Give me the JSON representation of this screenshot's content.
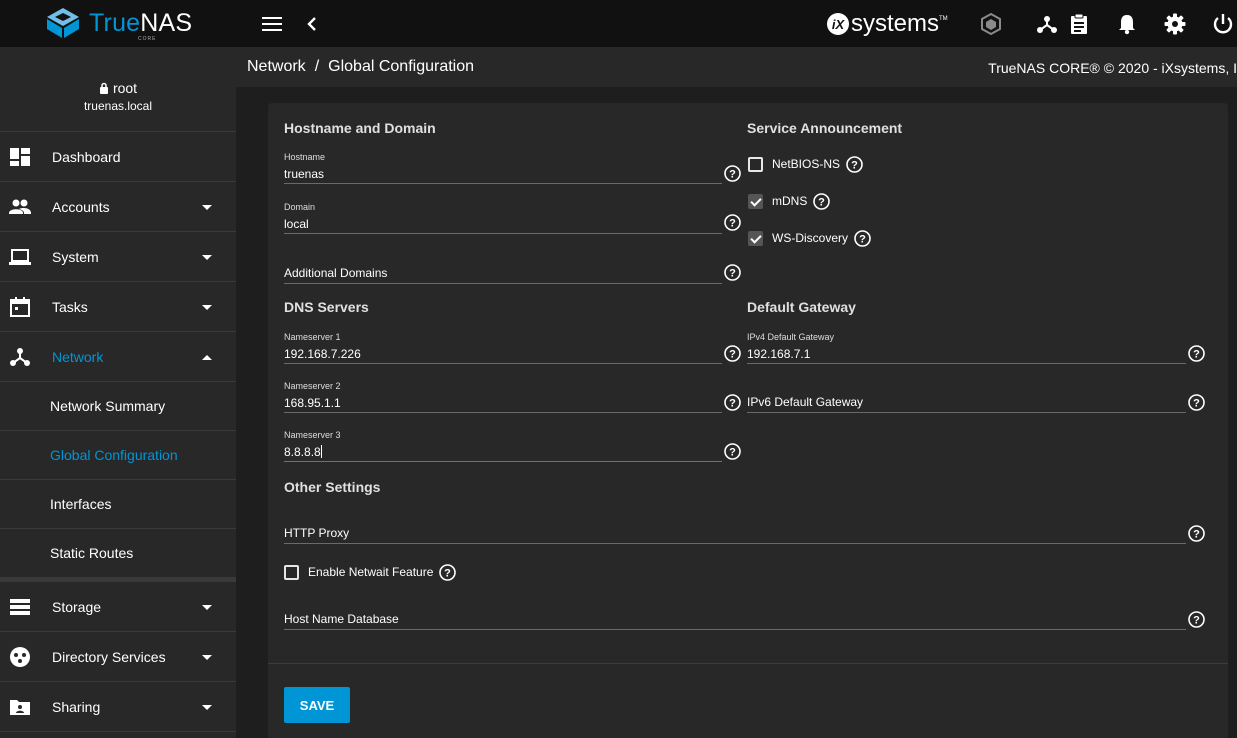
{
  "brand": {
    "name_part1": "True",
    "name_part2": "NAS",
    "sub": "CORE"
  },
  "topbar": {
    "vendor_logo_text": "systems",
    "icons": [
      "menu-icon",
      "back-chevron-icon",
      "truecommand-icon",
      "network-status-icon",
      "task-manager-icon",
      "notifications-icon",
      "settings-icon",
      "power-icon"
    ]
  },
  "user": {
    "name": "root",
    "host": "truenas.local"
  },
  "sidebar": {
    "items": [
      {
        "label": "Dashboard",
        "icon": "dashboard-icon"
      },
      {
        "label": "Accounts",
        "icon": "accounts-icon"
      },
      {
        "label": "System",
        "icon": "system-icon"
      },
      {
        "label": "Tasks",
        "icon": "tasks-icon"
      },
      {
        "label": "Network",
        "icon": "network-icon"
      }
    ],
    "network_sub": [
      "Network Summary",
      "Global Configuration",
      "Interfaces",
      "Static Routes"
    ],
    "items_after": [
      {
        "label": "Storage",
        "icon": "storage-icon"
      },
      {
        "label": "Directory Services",
        "icon": "directory-services-icon"
      },
      {
        "label": "Sharing",
        "icon": "sharing-icon"
      }
    ]
  },
  "breadcrumb": {
    "parent": "Network",
    "separator": "/",
    "current": "Global Configuration"
  },
  "copyright": "TrueNAS CORE® © 2020 - iXsystems, I",
  "form": {
    "hostname_domain": {
      "title": "Hostname and Domain",
      "hostname_label": "Hostname",
      "hostname_value": "truenas",
      "domain_label": "Domain",
      "domain_value": "local",
      "additional_domains_placeholder": "Additional Domains"
    },
    "service_announcement": {
      "title": "Service Announcement",
      "netbios_label": "NetBIOS-NS",
      "netbios_checked": false,
      "mdns_label": "mDNS",
      "mdns_checked": true,
      "wsd_label": "WS-Discovery",
      "wsd_checked": true
    },
    "dns": {
      "title": "DNS Servers",
      "ns1_label": "Nameserver 1",
      "ns1_value": "192.168.7.226",
      "ns2_label": "Nameserver 2",
      "ns2_value": "168.95.1.1",
      "ns3_label": "Nameserver 3",
      "ns3_value": "8.8.8.8"
    },
    "gateway": {
      "title": "Default Gateway",
      "ipv4_label": "IPv4 Default Gateway",
      "ipv4_value": "192.168.7.1",
      "ipv6_placeholder": "IPv6 Default Gateway"
    },
    "other": {
      "title": "Other Settings",
      "http_proxy_placeholder": "HTTP Proxy",
      "netwait_label": "Enable Netwait Feature",
      "netwait_checked": false,
      "host_db_placeholder": "Host Name Database"
    },
    "save_label": "SAVE"
  },
  "colors": {
    "accent": "#0095d5",
    "topbar": "#111111",
    "sidebar": "#282828",
    "card": "#282828",
    "background": "#1e1e1e"
  }
}
